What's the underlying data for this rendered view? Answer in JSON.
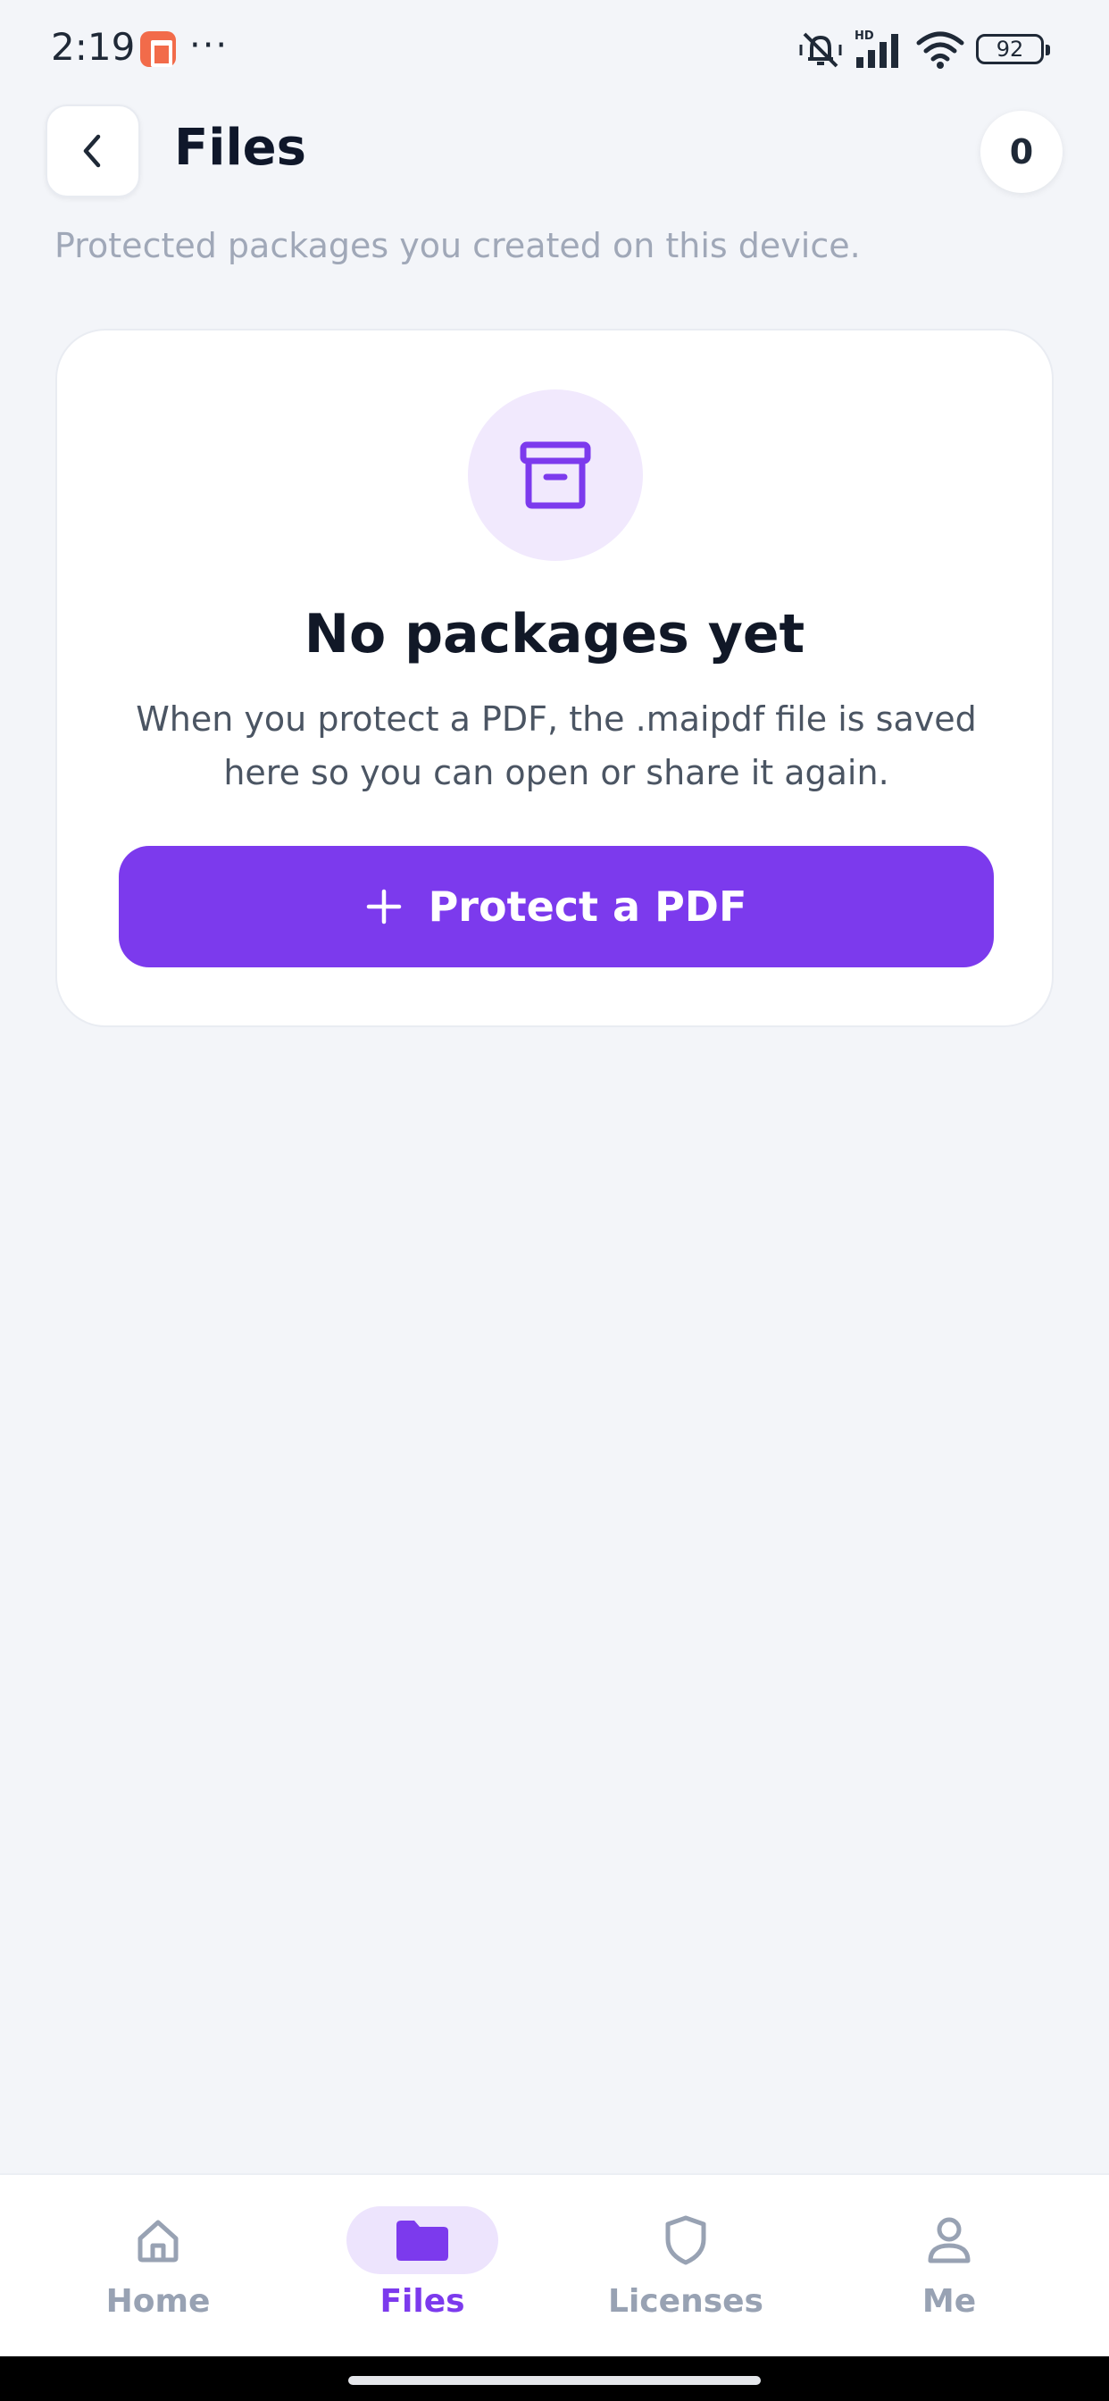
{
  "status_bar": {
    "time": "2:19",
    "dots": "···",
    "battery": "92"
  },
  "header": {
    "title": "Files",
    "count": "0",
    "subtitle": "Protected packages you created on this device."
  },
  "empty_state": {
    "icon": "archive-box-icon",
    "title": "No packages yet",
    "description": "When you protect a PDF, the .maipdf file is saved here so you can open or share it again.",
    "button_label": "Protect a PDF"
  },
  "bottom_nav": {
    "items": [
      {
        "label": "Home",
        "icon": "home-icon"
      },
      {
        "label": "Files",
        "icon": "folder-icon"
      },
      {
        "label": "Licenses",
        "icon": "shield-icon"
      },
      {
        "label": "Me",
        "icon": "person-icon"
      }
    ],
    "active": "Files"
  },
  "colors": {
    "accent": "#7c3aed",
    "accent_light": "#f1e9fd",
    "background": "#f3f5f9",
    "inactive": "#98a2b3"
  }
}
